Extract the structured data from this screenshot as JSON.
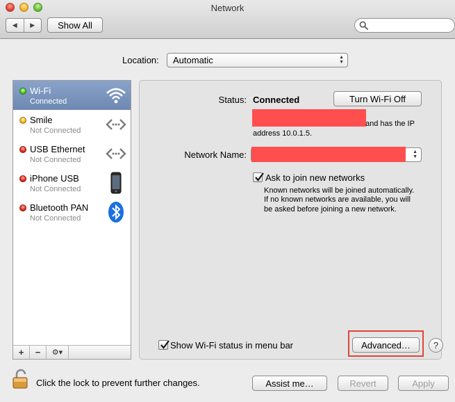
{
  "window": {
    "title": "Network"
  },
  "toolbar": {
    "back_glyph": "◀",
    "forward_glyph": "▶",
    "show_all_label": "Show All",
    "search_placeholder": ""
  },
  "location": {
    "label": "Location:",
    "value": "Automatic"
  },
  "services": [
    {
      "name": "Wi-Fi",
      "status": "Connected",
      "dot": "green",
      "icon": "wifi-icon",
      "selected": true
    },
    {
      "name": "Smile",
      "status": "Not Connected",
      "dot": "yellow",
      "icon": "ethernet-arrows-icon",
      "selected": false
    },
    {
      "name": "USB Ethernet",
      "status": "Not Connected",
      "dot": "red",
      "icon": "ethernet-arrows-icon",
      "selected": false
    },
    {
      "name": "iPhone USB",
      "status": "Not Connected",
      "dot": "red",
      "icon": "iphone-icon",
      "selected": false
    },
    {
      "name": "Bluetooth PAN",
      "status": "Not Connected",
      "dot": "red",
      "icon": "bluetooth-icon",
      "selected": false
    }
  ],
  "sidebar_buttons": {
    "add": "+",
    "remove": "−",
    "gear": "⚙▾"
  },
  "detail": {
    "status_label": "Status:",
    "status_value": "Connected",
    "turn_off_label": "Turn Wi-Fi Off",
    "status_desc_tail": "and has the IP",
    "status_desc_line2": "address 10.0.1.5.",
    "network_name_label": "Network Name:",
    "ask_join_label": "Ask to join new networks",
    "ask_join_checked": true,
    "ask_join_desc_1": "Known networks will be joined automatically.",
    "ask_join_desc_2": "If no known networks are available, you will",
    "ask_join_desc_3": "be asked before joining a new network.",
    "show_status_label": "Show Wi-Fi status in menu bar",
    "show_status_checked": true,
    "advanced_label": "Advanced…",
    "help_label": "?"
  },
  "footer": {
    "lock_text": "Click the lock to prevent further changes.",
    "assist_label": "Assist me…",
    "revert_label": "Revert",
    "apply_label": "Apply"
  },
  "colors": {
    "selection": "#7a93bd",
    "redaction": "#ff4e4e",
    "highlight": "#e0453a"
  }
}
